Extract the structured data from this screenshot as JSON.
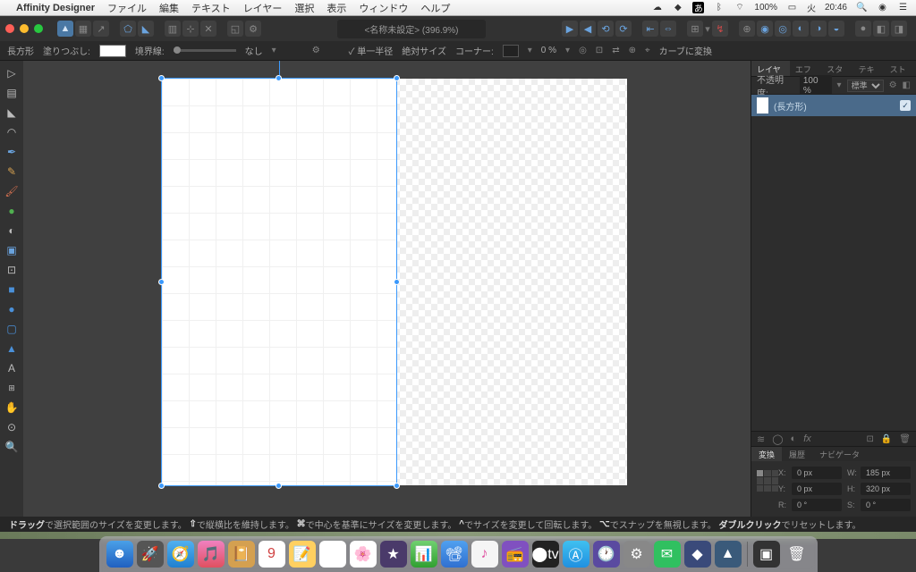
{
  "menubar": {
    "app_name": "Affinity Designer",
    "menus": [
      "ファイル",
      "編集",
      "テキスト",
      "レイヤー",
      "選択",
      "表示",
      "ウィンドウ",
      "ヘルプ"
    ],
    "status": {
      "battery": "100%",
      "ime": "あ",
      "day": "火",
      "time": "20:46"
    }
  },
  "document": {
    "title": "<名称未設定> (396.9%)"
  },
  "context": {
    "shape_label": "長方形",
    "fill_label": "塗りつぶし:",
    "stroke_label": "境界線:",
    "stroke_none": "なし",
    "single_radius": "単一半径",
    "abs_size": "絶対サイズ",
    "corner_label": "コーナー:",
    "corner_val": "0 %",
    "to_curves": "カーブに変換"
  },
  "panels": {
    "tabs": [
      "レイヤー",
      "エフェ",
      "スタイ",
      "テキス",
      "ストッ"
    ],
    "opacity_label": "不透明度:",
    "opacity_val": "100 %",
    "blend": "標準",
    "layer_name": "(長方形)",
    "transform_tabs": [
      "変換",
      "履歴",
      "ナビゲータ"
    ],
    "transform": {
      "x_label": "X:",
      "x_val": "0 px",
      "w_label": "W:",
      "w_val": "185 px",
      "y_label": "Y:",
      "y_val": "0 px",
      "h_label": "H:",
      "h_val": "320 px",
      "r_label": "R:",
      "r_val": "0 °",
      "s_label": "S:",
      "s_val": "0 °"
    }
  },
  "hints": {
    "drag": "ドラッグ",
    "drag_txt": "で選択範囲のサイズを変更します。",
    "shift": "⇧",
    "shift_txt": "で縦横比を維持します。",
    "cmd": "⌘",
    "cmd_txt": "で中心を基準にサイズを変更します。",
    "ctrl": "^",
    "ctrl_txt": "でサイズを変更して回転します。",
    "opt": "⌥",
    "opt_txt": "でスナップを無視します。",
    "dbl": "ダブルクリック",
    "dbl_txt": "でリセットします。"
  }
}
